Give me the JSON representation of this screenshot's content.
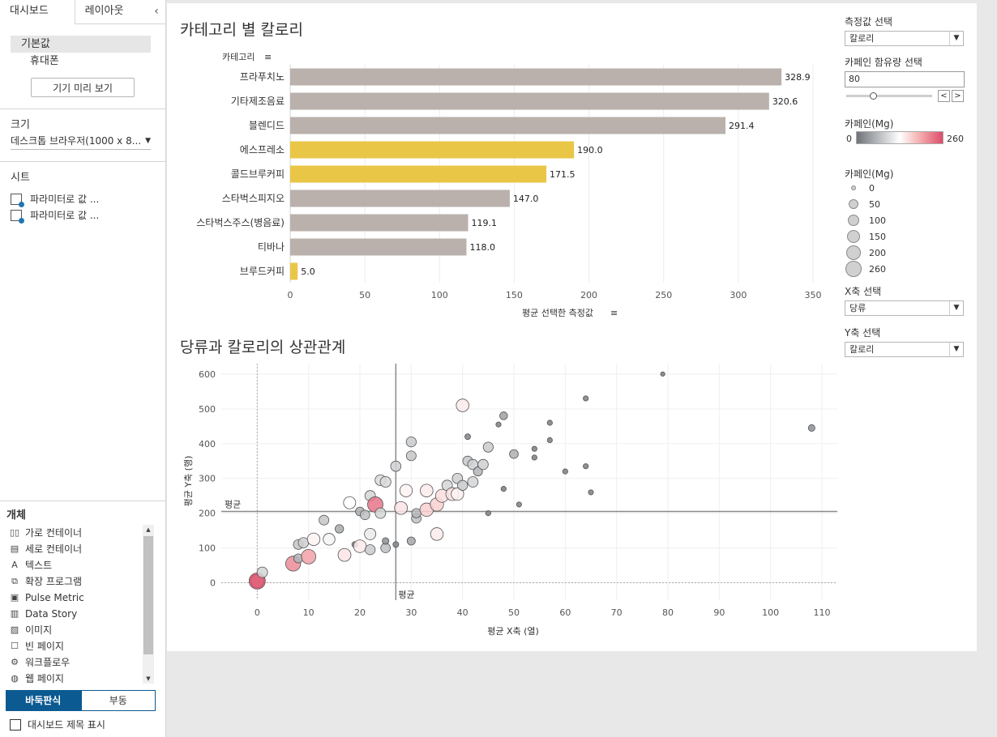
{
  "left_panel": {
    "tabs": [
      "대시보드",
      "레이아웃"
    ],
    "collapse_glyph": "‹",
    "devices": [
      "기본값",
      "휴대폰"
    ],
    "preview_button": "기기 미리 보기",
    "size_section": "크기",
    "size_value": "데스크톱 브라우저(1000 x 8...",
    "sheets_section": "시트",
    "sheets": [
      "파라미터로 값 ...",
      "파라미터로 값 ..."
    ],
    "objects_section": "개체",
    "objects": [
      {
        "icon": "horizontal-container-icon",
        "glyph": "▯▯",
        "label": "가로 컨테이너"
      },
      {
        "icon": "vertical-container-icon",
        "glyph": "▤",
        "label": "세로 컨테이너"
      },
      {
        "icon": "text-icon",
        "glyph": "A",
        "label": "텍스트"
      },
      {
        "icon": "extension-icon",
        "glyph": "⧉",
        "label": "확장 프로그램"
      },
      {
        "icon": "pulse-metric-icon",
        "glyph": "▣",
        "label": "Pulse Metric"
      },
      {
        "icon": "data-story-icon",
        "glyph": "▥",
        "label": "Data Story"
      },
      {
        "icon": "image-icon",
        "glyph": "▨",
        "label": "이미지"
      },
      {
        "icon": "blank-icon",
        "glyph": "☐",
        "label": "빈 페이지"
      },
      {
        "icon": "workflow-icon",
        "glyph": "⚙",
        "label": "워크플로우"
      },
      {
        "icon": "web-page-icon",
        "glyph": "◍",
        "label": "웹 페이지"
      }
    ],
    "layout_toggle": [
      "바둑판식",
      "부동"
    ],
    "show_title_label": "대시보드 제목 표시"
  },
  "bar_chart": {
    "title": "카테고리 별 칼로리",
    "row_header": "카테고리",
    "x_axis_label": "평균 선택한 측정값"
  },
  "scatter_chart": {
    "title": "당류과 칼로리의 상관관계",
    "x_axis_label": "평균 X축 (열)",
    "y_axis_label": "평균 Y축 (행)",
    "avg_label_h": "평균",
    "avg_label_v": "평균"
  },
  "controls": {
    "measure_label": "측정값 선택",
    "measure_value": "칼로리",
    "caffeine_param_label": "카페인 함유량 선택",
    "caffeine_param_value": "80",
    "slider_fraction": 0.31,
    "color_legend_title": "카페인(Mg)",
    "color_min": "0",
    "color_max": "260",
    "size_legend_title": "카페인(Mg)",
    "size_legend_values": [
      "0",
      "50",
      "100",
      "150",
      "200",
      "260"
    ],
    "x_axis_select_label": "X축 선택",
    "x_axis_select_value": "당류",
    "y_axis_select_label": "Y축 선택",
    "y_axis_select_value": "칼로리"
  },
  "colors": {
    "bar_default": "#bab0ac",
    "bar_highlight": "#e9c646",
    "brand_blue": "#0b5a91",
    "caffeine_low": "#6f7378",
    "caffeine_high": "#dc4c6a"
  },
  "chart_data": [
    {
      "type": "bar",
      "orientation": "horizontal",
      "title": "카테고리 별 칼로리",
      "categories": [
        "프라푸치노",
        "기타제조음료",
        "블렌디드",
        "에스프레소",
        "콜드브루커피",
        "스타벅스피지오",
        "스타벅스주스(병음료)",
        "티바나",
        "브루드커피"
      ],
      "values": [
        328.9,
        320.6,
        291.4,
        190.0,
        171.5,
        147.0,
        119.1,
        118.0,
        5.0
      ],
      "value_labels": [
        "328.9",
        "320.6",
        "291.4",
        "190.0",
        "171.5",
        "147.0",
        "119.1",
        "118.0",
        "5.0"
      ],
      "highlighted": [
        false,
        false,
        false,
        true,
        true,
        false,
        false,
        false,
        true
      ],
      "xlabel": "평균 선택한 측정값",
      "ylabel": "카테고리",
      "xlim": [
        0,
        350
      ],
      "xticks": [
        0,
        50,
        100,
        150,
        200,
        250,
        300,
        350
      ]
    },
    {
      "type": "scatter",
      "title": "당류과 칼로리의 상관관계",
      "xlabel": "평균 X축 (열)",
      "ylabel": "평균 Y축 (행)",
      "xlim": [
        -7,
        113
      ],
      "ylim": [
        -50,
        630
      ],
      "xticks": [
        0,
        10,
        20,
        30,
        40,
        50,
        60,
        70,
        80,
        90,
        100,
        110
      ],
      "yticks": [
        0,
        100,
        200,
        300,
        400,
        500,
        600
      ],
      "reference_lines": {
        "x_avg": 27,
        "y_avg": 205
      },
      "caffeine_range": [
        0,
        260
      ],
      "points": [
        {
          "x": 0,
          "y": 5,
          "c": 150
        },
        {
          "x": 0,
          "y": 5,
          "c": 260
        },
        {
          "x": 1,
          "y": 30,
          "c": 90
        },
        {
          "x": 7,
          "y": 55,
          "c": 215
        },
        {
          "x": 8,
          "y": 70,
          "c": 60
        },
        {
          "x": 8,
          "y": 110,
          "c": 75
        },
        {
          "x": 9,
          "y": 115,
          "c": 85
        },
        {
          "x": 10,
          "y": 75,
          "c": 200
        },
        {
          "x": 11,
          "y": 125,
          "c": 140
        },
        {
          "x": 13,
          "y": 180,
          "c": 75
        },
        {
          "x": 14,
          "y": 125,
          "c": 120
        },
        {
          "x": 16,
          "y": 155,
          "c": 50
        },
        {
          "x": 17,
          "y": 80,
          "c": 150
        },
        {
          "x": 18,
          "y": 230,
          "c": 130
        },
        {
          "x": 19,
          "y": 110,
          "c": 15
        },
        {
          "x": 20,
          "y": 105,
          "c": 145
        },
        {
          "x": 20,
          "y": 205,
          "c": 55
        },
        {
          "x": 21,
          "y": 195,
          "c": 70
        },
        {
          "x": 22,
          "y": 250,
          "c": 90
        },
        {
          "x": 22,
          "y": 140,
          "c": 110
        },
        {
          "x": 22,
          "y": 95,
          "c": 80
        },
        {
          "x": 23,
          "y": 225,
          "c": 230
        },
        {
          "x": 24,
          "y": 200,
          "c": 90
        },
        {
          "x": 24,
          "y": 295,
          "c": 95
        },
        {
          "x": 25,
          "y": 290,
          "c": 95
        },
        {
          "x": 25,
          "y": 100,
          "c": 70
        },
        {
          "x": 25,
          "y": 120,
          "c": 25
        },
        {
          "x": 27,
          "y": 110,
          "c": 15
        },
        {
          "x": 27,
          "y": 335,
          "c": 85
        },
        {
          "x": 28,
          "y": 215,
          "c": 150
        },
        {
          "x": 29,
          "y": 265,
          "c": 140
        },
        {
          "x": 30,
          "y": 120,
          "c": 45
        },
        {
          "x": 30,
          "y": 365,
          "c": 75
        },
        {
          "x": 30,
          "y": 405,
          "c": 80
        },
        {
          "x": 31,
          "y": 185,
          "c": 70
        },
        {
          "x": 31,
          "y": 200,
          "c": 65
        },
        {
          "x": 33,
          "y": 265,
          "c": 145
        },
        {
          "x": 33,
          "y": 210,
          "c": 165
        },
        {
          "x": 35,
          "y": 225,
          "c": 165
        },
        {
          "x": 35,
          "y": 140,
          "c": 145
        },
        {
          "x": 36,
          "y": 250,
          "c": 155
        },
        {
          "x": 37,
          "y": 280,
          "c": 90
        },
        {
          "x": 38,
          "y": 255,
          "c": 150
        },
        {
          "x": 39,
          "y": 300,
          "c": 85
        },
        {
          "x": 39,
          "y": 255,
          "c": 140
        },
        {
          "x": 40,
          "y": 510,
          "c": 145
        },
        {
          "x": 40,
          "y": 280,
          "c": 80
        },
        {
          "x": 41,
          "y": 350,
          "c": 75
        },
        {
          "x": 42,
          "y": 340,
          "c": 85
        },
        {
          "x": 42,
          "y": 290,
          "c": 90
        },
        {
          "x": 43,
          "y": 320,
          "c": 60
        },
        {
          "x": 44,
          "y": 340,
          "c": 85
        },
        {
          "x": 45,
          "y": 390,
          "c": 80
        },
        {
          "x": 41,
          "y": 420,
          "c": 15
        },
        {
          "x": 45,
          "y": 200,
          "c": 10
        },
        {
          "x": 47,
          "y": 455,
          "c": 10
        },
        {
          "x": 48,
          "y": 480,
          "c": 40
        },
        {
          "x": 48,
          "y": 270,
          "c": 10
        },
        {
          "x": 50,
          "y": 370,
          "c": 55
        },
        {
          "x": 51,
          "y": 225,
          "c": 10
        },
        {
          "x": 54,
          "y": 385,
          "c": 10
        },
        {
          "x": 54,
          "y": 360,
          "c": 10
        },
        {
          "x": 57,
          "y": 460,
          "c": 10
        },
        {
          "x": 57,
          "y": 410,
          "c": 10
        },
        {
          "x": 60,
          "y": 320,
          "c": 10
        },
        {
          "x": 64,
          "y": 530,
          "c": 10
        },
        {
          "x": 64,
          "y": 335,
          "c": 10
        },
        {
          "x": 65,
          "y": 260,
          "c": 10
        },
        {
          "x": 79,
          "y": 600,
          "c": 5
        },
        {
          "x": 108,
          "y": 445,
          "c": 25
        }
      ]
    }
  ]
}
